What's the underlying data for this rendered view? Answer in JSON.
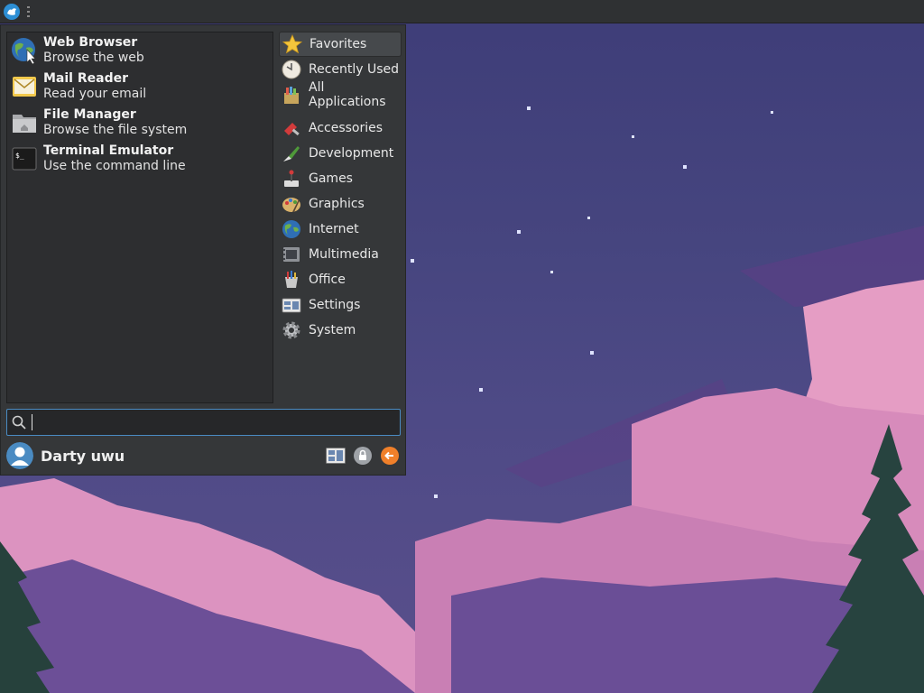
{
  "favorites": [
    {
      "title": "Web Browser",
      "description": "Browse the web",
      "icon": "web-browser-icon"
    },
    {
      "title": "Mail Reader",
      "description": "Read your email",
      "icon": "mail-reader-icon"
    },
    {
      "title": "File Manager",
      "description": "Browse the file system",
      "icon": "file-manager-icon"
    },
    {
      "title": "Terminal Emulator",
      "description": "Use the command line",
      "icon": "terminal-icon"
    }
  ],
  "categories": [
    {
      "label": "Favorites",
      "icon": "star-icon",
      "active": true
    },
    {
      "label": "Recently Used",
      "icon": "clock-icon"
    },
    {
      "label": "All Applications",
      "icon": "all-applications-icon"
    },
    {
      "label": "Accessories",
      "icon": "accessories-icon"
    },
    {
      "label": "Development",
      "icon": "development-icon"
    },
    {
      "label": "Games",
      "icon": "games-icon"
    },
    {
      "label": "Graphics",
      "icon": "graphics-icon"
    },
    {
      "label": "Internet",
      "icon": "internet-icon"
    },
    {
      "label": "Multimedia",
      "icon": "multimedia-icon"
    },
    {
      "label": "Office",
      "icon": "office-icon"
    },
    {
      "label": "Settings",
      "icon": "settings-icon"
    },
    {
      "label": "System",
      "icon": "system-icon"
    }
  ],
  "search": {
    "value": "",
    "placeholder": ""
  },
  "user": {
    "name": "Darty uwu"
  },
  "colors": {
    "accent": "#4a8bc2",
    "panel": "#2f3133",
    "menu": "#353739",
    "logout": "#f0802a"
  }
}
